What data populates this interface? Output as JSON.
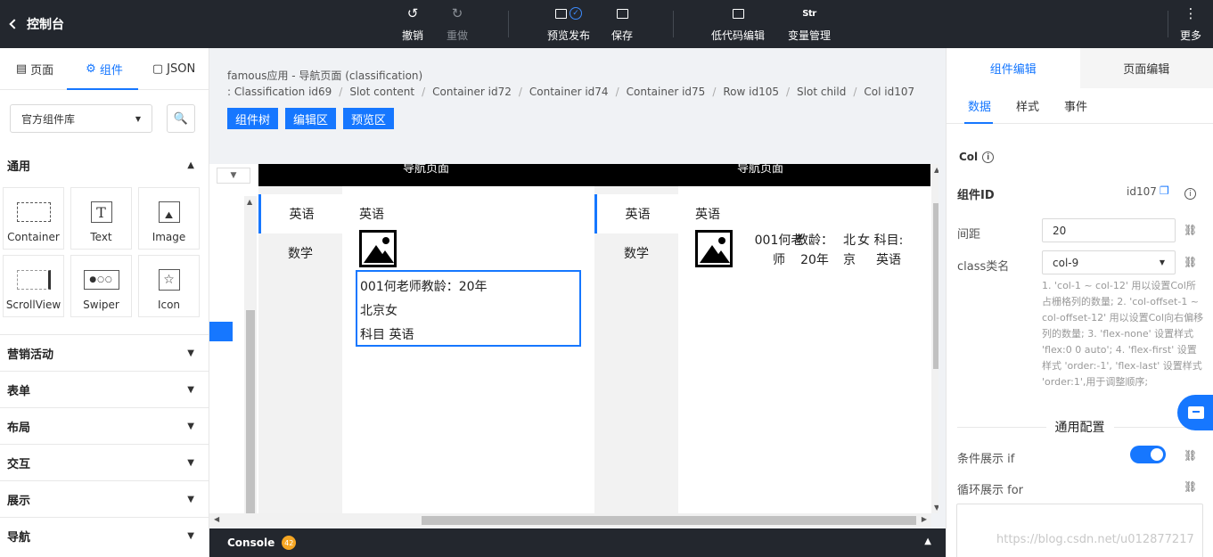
{
  "topbar": {
    "back_label": "控制台",
    "undo": "撤销",
    "redo": "重做",
    "preview_publish": "预览发布",
    "save": "保存",
    "lowcode": "低代码编辑",
    "var_icon": "Str",
    "var_mgmt": "变量管理",
    "more": "更多"
  },
  "left": {
    "tabs": [
      "页面",
      "组件",
      "JSON"
    ],
    "library": "官方组件库",
    "category_general": "通用",
    "components": [
      "Container",
      "Text",
      "Image",
      "ScrollView",
      "Swiper",
      "Icon"
    ],
    "categories": [
      "营销活动",
      "表单",
      "布局",
      "交互",
      "展示",
      "导航"
    ]
  },
  "mid": {
    "title": "famous应用 - 导航页面 (classification)",
    "breadcrumb": [
      ": Classification id69",
      "Slot content",
      "Container id72",
      "Container id74",
      "Container id75",
      "Row id105",
      "Slot child",
      "Col id107"
    ],
    "modes": [
      "组件树",
      "编辑区",
      "预览区"
    ],
    "nav_title": "导航页面",
    "side_tabs": [
      "英语",
      "数学"
    ],
    "category_title": "英语",
    "card_lines": [
      "001何老师教龄：20年",
      "北京女",
      "科目 英语"
    ],
    "row_cols": [
      "001何老\n师",
      "教龄：\n20年",
      "北\n京",
      "女",
      "科目:\n英语"
    ],
    "console": "Console",
    "console_count": "42"
  },
  "right": {
    "tabs": [
      "组件编辑",
      "页面编辑"
    ],
    "subtabs": [
      "数据",
      "样式",
      "事件"
    ],
    "comp_type": "Col",
    "comp_id_label": "组件ID",
    "comp_id": "id107",
    "gap_label": "间距",
    "gap_value": "20",
    "class_label": "class类名",
    "class_value": "col-9",
    "hint": "1. 'col-1 ~ col-12' 用以设置Col所占栅格列的数量; 2. 'col-offset-1 ~ col-offset-12' 用以设置Col向右偏移列的数量; 3. 'flex-none' 设置样式 'flex:0 0 auto'; 4. 'flex-first' 设置样式 'order:-1', 'flex-last' 设置样式 'order:1',用于调整顺序;",
    "section_general": "通用配置",
    "cond_label": "条件展示 if",
    "loop_label": "循环展示 for"
  },
  "watermark": "https://blog.csdn.net/u012877217",
  "colors": {
    "accent": "#1677ff",
    "topbar": "#23272e",
    "badge": "#f5a623"
  }
}
